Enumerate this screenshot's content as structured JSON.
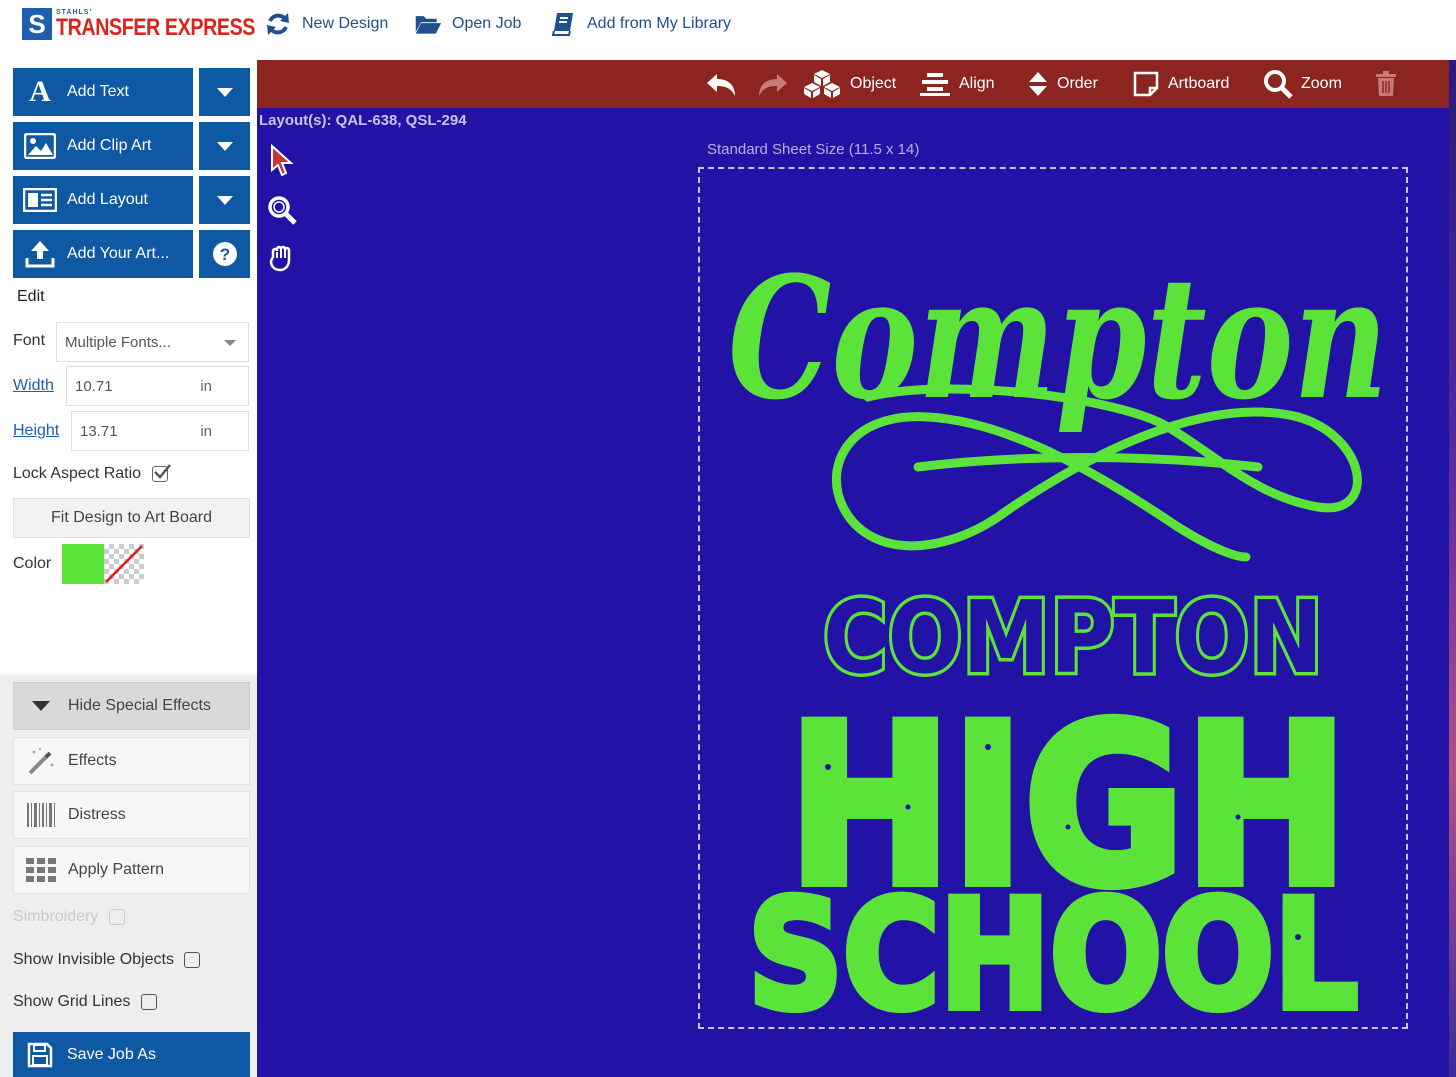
{
  "header": {
    "logo_small": "STAHLS'",
    "logo_main": "TRANSFER EXPRESS",
    "logo_letter": "S",
    "links": [
      {
        "label": "New Design",
        "icon": "refresh-icon"
      },
      {
        "label": "Open Job",
        "icon": "folder-open-icon"
      },
      {
        "label": "Add from My Library",
        "icon": "book-icon"
      }
    ]
  },
  "sidebar": {
    "add_text": "Add Text",
    "add_clip_art": "Add Clip Art",
    "add_layout": "Add Layout",
    "add_your_art": "Add Your Art...",
    "edit_label": "Edit",
    "font_label": "Font",
    "font_value": "Multiple Fonts...",
    "width_label": "Width",
    "width_value": "10.71",
    "height_label": "Height",
    "height_value": "13.71",
    "unit": "in",
    "lock_aspect_label": "Lock Aspect Ratio",
    "lock_aspect_checked": true,
    "fit_design_label": "Fit Design to Art Board",
    "color_label": "Color",
    "color_value": "#5be33a",
    "hide_effects_label": "Hide Special Effects",
    "effects_label": "Effects",
    "distress_label": "Distress",
    "apply_pattern_label": "Apply Pattern",
    "simbroidery_label": "Simbroidery",
    "show_invisible_label": "Show Invisible Objects",
    "show_grid_label": "Show Grid Lines",
    "save_job_label": "Save Job As"
  },
  "toolbar": {
    "object_label": "Object",
    "align_label": "Align",
    "order_label": "Order",
    "artboard_label": "Artboard",
    "zoom_label": "Zoom"
  },
  "canvas": {
    "layouts_label": "Layout(s): QAL-638, QSL-294",
    "sheet_label": "Standard Sheet Size (11.5 x 14)",
    "background_color": "#2212a6",
    "design_color": "#5be33a",
    "script_text": "Compton",
    "block_line1": "COMPTON",
    "block_line2": "HIGH",
    "block_line3": "SCHOOL"
  }
}
